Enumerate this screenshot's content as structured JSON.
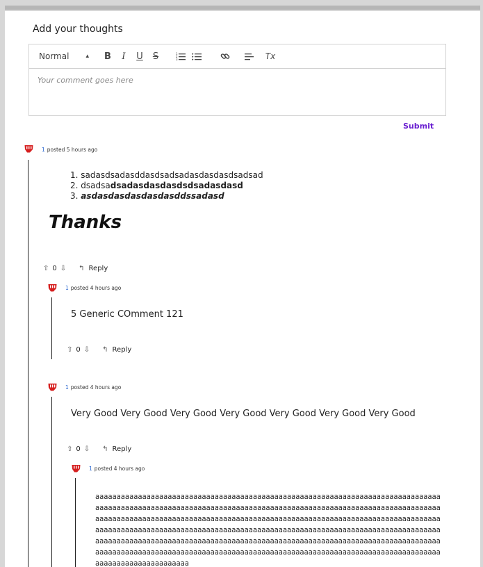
{
  "editor": {
    "heading": "Add your thoughts",
    "format_select": "Normal",
    "toolbar": {
      "bold": "B",
      "italic": "I",
      "underline": "U",
      "strike": "S",
      "clear_format": "Tx"
    },
    "placeholder": "Your comment goes here",
    "submit_label": "Submit"
  },
  "colors": {
    "accent": "#6a1fd1",
    "author_link": "#1f5fcf",
    "avatar_red": "#d61f1f"
  },
  "comments": {
    "c1": {
      "author": "1",
      "time": "posted 5 hours ago",
      "list": [
        "sadasdsadasddasdsadsadasdasdasdsadsad",
        "dsadsa",
        "dsadasdasdasdsdsadasdasd",
        "asdasdasdasdasdasddssadasd"
      ],
      "list_numbers": [
        "1.",
        "2.",
        "3."
      ],
      "thanks": "Thanks",
      "votes": "0",
      "reply_label": "Reply"
    },
    "c2": {
      "author": "1",
      "time": "posted 4 hours ago",
      "text": "5 Generic COmment 121",
      "votes": "0",
      "reply_label": "Reply"
    },
    "c3": {
      "author": "1",
      "time": "posted 4 hours ago",
      "text": "Very Good Very Good Very Good Very Good Very Good Very Good Very Good",
      "votes": "0",
      "reply_label": "Reply"
    },
    "c4": {
      "author": "1",
      "time": "posted 4 hours ago",
      "lines": [
        "aaaaaaaaaaaaaaaaaaaaaaaaaaaaaaaaaaaaaaaaaaaaaaaaaaaaaaaaaaaaaaaaaaaaaaaaaaaaaaaaa",
        "aaaaaaaaaaaaaaaaaaaaaaaaaaaaaaaaaaaaaaaaaaaaaaaaaaaaaaaaaaaaaaaaaaaaaaaaaaaaaaaaa",
        "aaaaaaaaaaaaaaaaaaaaaaaaaaaaaaaaaaaaaaaaaaaaaaaaaaaaaaaaaaaaaaaaaaaaaaaaaaaaaaaaa",
        "aaaaaaaaaaaaaaaaaaaaaaaaaaaaaaaaaaaaaaaaaaaaaaaaaaaaaaaaaaaaaaaaaaaaaaaaaaaaaaaaa",
        "aaaaaaaaaaaaaaaaaaaaaaaaaaaaaaaaaaaaaaaaaaaaaaaaaaaaaaaaaaaaaaaaaaaaaaaaaaaaaaaaa",
        "aaaaaaaaaaaaaaaaaaaaaaaaaaaaaaaaaaaaaaaaaaaaaaaaaaaaaaaaaaaaaaaaaaaaaaaaaaaaaaaaa",
        "aaaaaaaaaaaaaaaaaaaaaa"
      ]
    }
  }
}
